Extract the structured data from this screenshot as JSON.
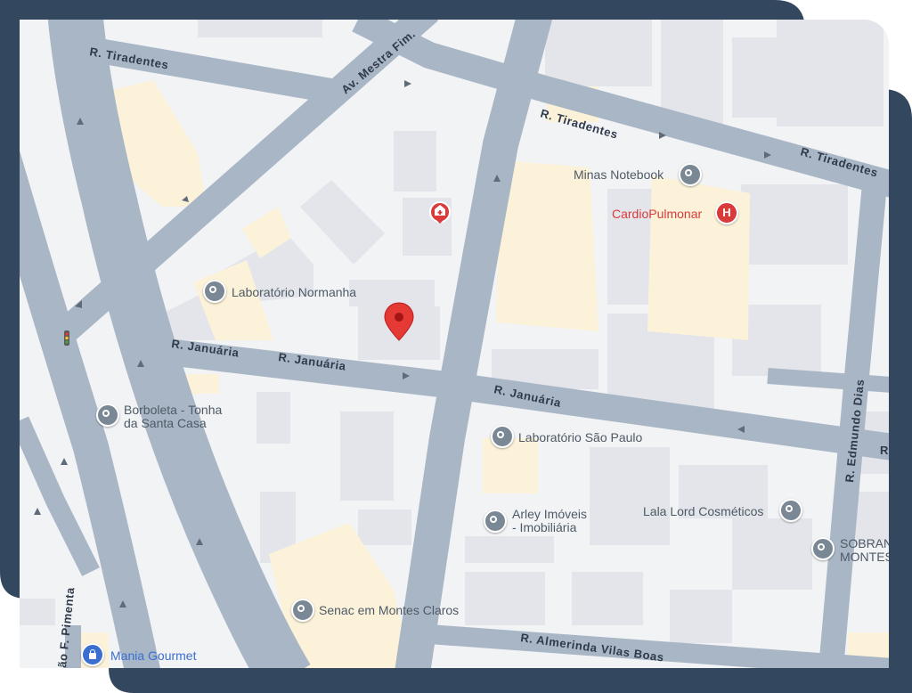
{
  "colors": {
    "frame": "#33475f",
    "map_bg": "#f2f3f5",
    "road": "#a9b6c6",
    "road_edge": "#95a3b6",
    "block": "#e3e5ea",
    "building_yellow": "#fbf2d9",
    "poi_gray": "#7a8794",
    "poi_red": "#d93a3a",
    "poi_blue": "#3a6fd0",
    "marker": "#e53935"
  },
  "streets": {
    "tiradentes_1": "R. Tiradentes",
    "tiradentes_2": "R. Tiradentes",
    "tiradentes_3": "R. Tiradentes",
    "mestre_fim": "Av. Mestra Fim.",
    "januaria_1": "R. Januária",
    "januaria_2": "R. Januária",
    "januaria_3": "R. Januária",
    "edmundo_dias": "R. Edmundo Dias",
    "almerinda": "R. Almerinda Vilas Boas",
    "pimenta": "ão F. Pimenta",
    "edge_r": "R"
  },
  "pois": {
    "minas_notebook": "Minas Notebook",
    "cardiopulmonar": "CardioPulmonar",
    "laboratorio_normanha": "Laboratório Normanha",
    "borboleta_line1": "Borboleta - Tonha",
    "borboleta_line2": "da Santa Casa",
    "laboratorio_sao_paulo": "Laboratório São Paulo",
    "arley_line1": "Arley Imóveis",
    "arley_line2": "- Imobiliária",
    "lala_lord": "Lala Lord Cosméticos",
    "sobran_line1": "SOBRAN",
    "sobran_line2": "MONTES",
    "senac": "Senac em Montes Claros",
    "mania_gourmet": "Mania Gourmet"
  },
  "icons": {
    "poi_pin": "location-pin-icon",
    "hospital": "hospital-icon",
    "shopping": "shopping-bag-icon",
    "traffic_light": "traffic-light-icon",
    "marker": "map-marker-icon",
    "arrow": "one-way-arrow-icon"
  }
}
